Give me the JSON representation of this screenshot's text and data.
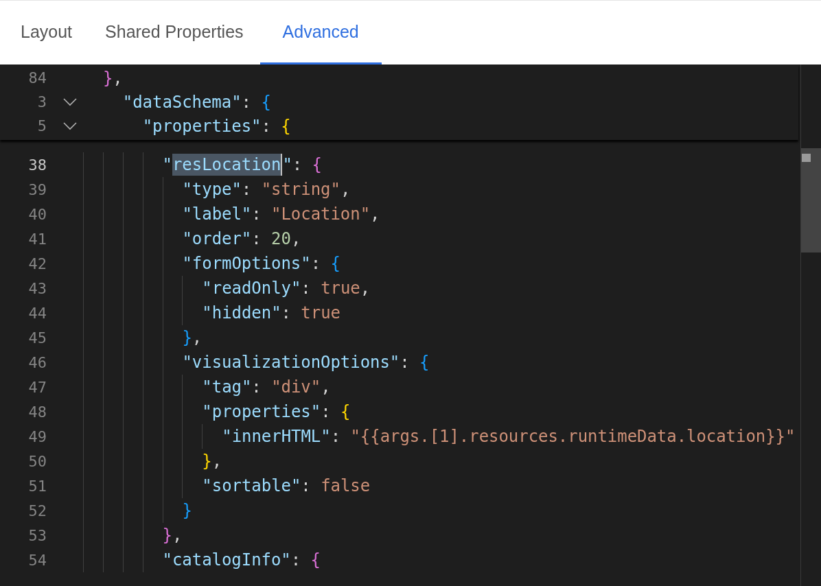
{
  "tabs": [
    {
      "label": "Layout",
      "selected": false
    },
    {
      "label": "Shared Properties",
      "selected": false
    },
    {
      "label": "Advanced",
      "selected": true
    }
  ],
  "sticky_lines": [
    {
      "number": "84",
      "tokens": [
        {
          "kind": "close",
          "text": "}",
          "color": "#da70d6"
        },
        {
          "kind": "punct",
          "text": ","
        }
      ]
    },
    {
      "number": "3",
      "expanded": true,
      "tokens": [
        {
          "kind": "key",
          "text": "\"dataSchema\""
        },
        {
          "kind": "punct",
          "text": ": "
        },
        {
          "kind": "open",
          "text": "{",
          "color": "#179fff"
        }
      ]
    },
    {
      "number": "5",
      "expanded": true,
      "tokens": [
        {
          "kind": "key",
          "text": "\"properties\""
        },
        {
          "kind": "punct",
          "text": ": "
        },
        {
          "kind": "open",
          "text": "{",
          "color": "#ffd700"
        }
      ]
    }
  ],
  "lines": [
    {
      "number": "38",
      "current": true,
      "tokens": [
        {
          "kind": "key",
          "text": "\""
        },
        {
          "kind": "key",
          "text": "resLocation",
          "highlighted": true
        },
        {
          "kind": "key",
          "text": "\""
        },
        {
          "kind": "punct",
          "text": ": "
        },
        {
          "kind": "open",
          "text": "{",
          "color": "#da70d6"
        }
      ]
    },
    {
      "number": "39",
      "tokens": [
        {
          "kind": "key",
          "text": "\"type\""
        },
        {
          "kind": "punct",
          "text": ": "
        },
        {
          "kind": "string",
          "text": "\"string\""
        },
        {
          "kind": "punct",
          "text": ","
        }
      ]
    },
    {
      "number": "40",
      "tokens": [
        {
          "kind": "key",
          "text": "\"label\""
        },
        {
          "kind": "punct",
          "text": ": "
        },
        {
          "kind": "string",
          "text": "\"Location\""
        },
        {
          "kind": "punct",
          "text": ","
        }
      ]
    },
    {
      "number": "41",
      "tokens": [
        {
          "kind": "key",
          "text": "\"order\""
        },
        {
          "kind": "punct",
          "text": ": "
        },
        {
          "kind": "number",
          "text": "20"
        },
        {
          "kind": "punct",
          "text": ","
        }
      ]
    },
    {
      "number": "42",
      "tokens": [
        {
          "kind": "key",
          "text": "\"formOptions\""
        },
        {
          "kind": "punct",
          "text": ": "
        },
        {
          "kind": "open",
          "text": "{",
          "color": "#179fff"
        }
      ]
    },
    {
      "number": "43",
      "tokens": [
        {
          "kind": "key",
          "text": "\"readOnly\""
        },
        {
          "kind": "punct",
          "text": ": "
        },
        {
          "kind": "keyword",
          "text": "true"
        },
        {
          "kind": "punct",
          "text": ","
        }
      ]
    },
    {
      "number": "44",
      "tokens": [
        {
          "kind": "key",
          "text": "\"hidden\""
        },
        {
          "kind": "punct",
          "text": ": "
        },
        {
          "kind": "keyword",
          "text": "true"
        }
      ]
    },
    {
      "number": "45",
      "tokens": [
        {
          "kind": "close",
          "text": "}",
          "color": "#179fff"
        },
        {
          "kind": "punct",
          "text": ","
        }
      ]
    },
    {
      "number": "46",
      "tokens": [
        {
          "kind": "key",
          "text": "\"visualizationOptions\""
        },
        {
          "kind": "punct",
          "text": ": "
        },
        {
          "kind": "open",
          "text": "{",
          "color": "#179fff"
        }
      ]
    },
    {
      "number": "47",
      "tokens": [
        {
          "kind": "key",
          "text": "\"tag\""
        },
        {
          "kind": "punct",
          "text": ": "
        },
        {
          "kind": "string",
          "text": "\"div\""
        },
        {
          "kind": "punct",
          "text": ","
        }
      ]
    },
    {
      "number": "48",
      "tokens": [
        {
          "kind": "key",
          "text": "\"properties\""
        },
        {
          "kind": "punct",
          "text": ": "
        },
        {
          "kind": "open",
          "text": "{",
          "color": "#ffd700"
        }
      ]
    },
    {
      "number": "49",
      "tokens": [
        {
          "kind": "key",
          "text": "\"innerHTML\""
        },
        {
          "kind": "punct",
          "text": ": "
        },
        {
          "kind": "string",
          "text": "\"{{args.[1].resources.runtimeData.location}}\""
        }
      ]
    },
    {
      "number": "50",
      "tokens": [
        {
          "kind": "close",
          "text": "}",
          "color": "#ffd700"
        },
        {
          "kind": "punct",
          "text": ","
        }
      ]
    },
    {
      "number": "51",
      "tokens": [
        {
          "kind": "key",
          "text": "\"sortable\""
        },
        {
          "kind": "punct",
          "text": ": "
        },
        {
          "kind": "keyword",
          "text": "false"
        }
      ]
    },
    {
      "number": "52",
      "tokens": [
        {
          "kind": "close",
          "text": "}",
          "color": "#179fff"
        }
      ]
    },
    {
      "number": "53",
      "tokens": [
        {
          "kind": "close",
          "text": "}",
          "color": "#da70d6"
        },
        {
          "kind": "punct",
          "text": ","
        }
      ]
    },
    {
      "number": "54",
      "tokens": [
        {
          "kind": "key",
          "text": "\"catalogInfo\""
        },
        {
          "kind": "punct",
          "text": ": "
        },
        {
          "kind": "open",
          "text": "{",
          "color": "#da70d6"
        }
      ]
    }
  ]
}
